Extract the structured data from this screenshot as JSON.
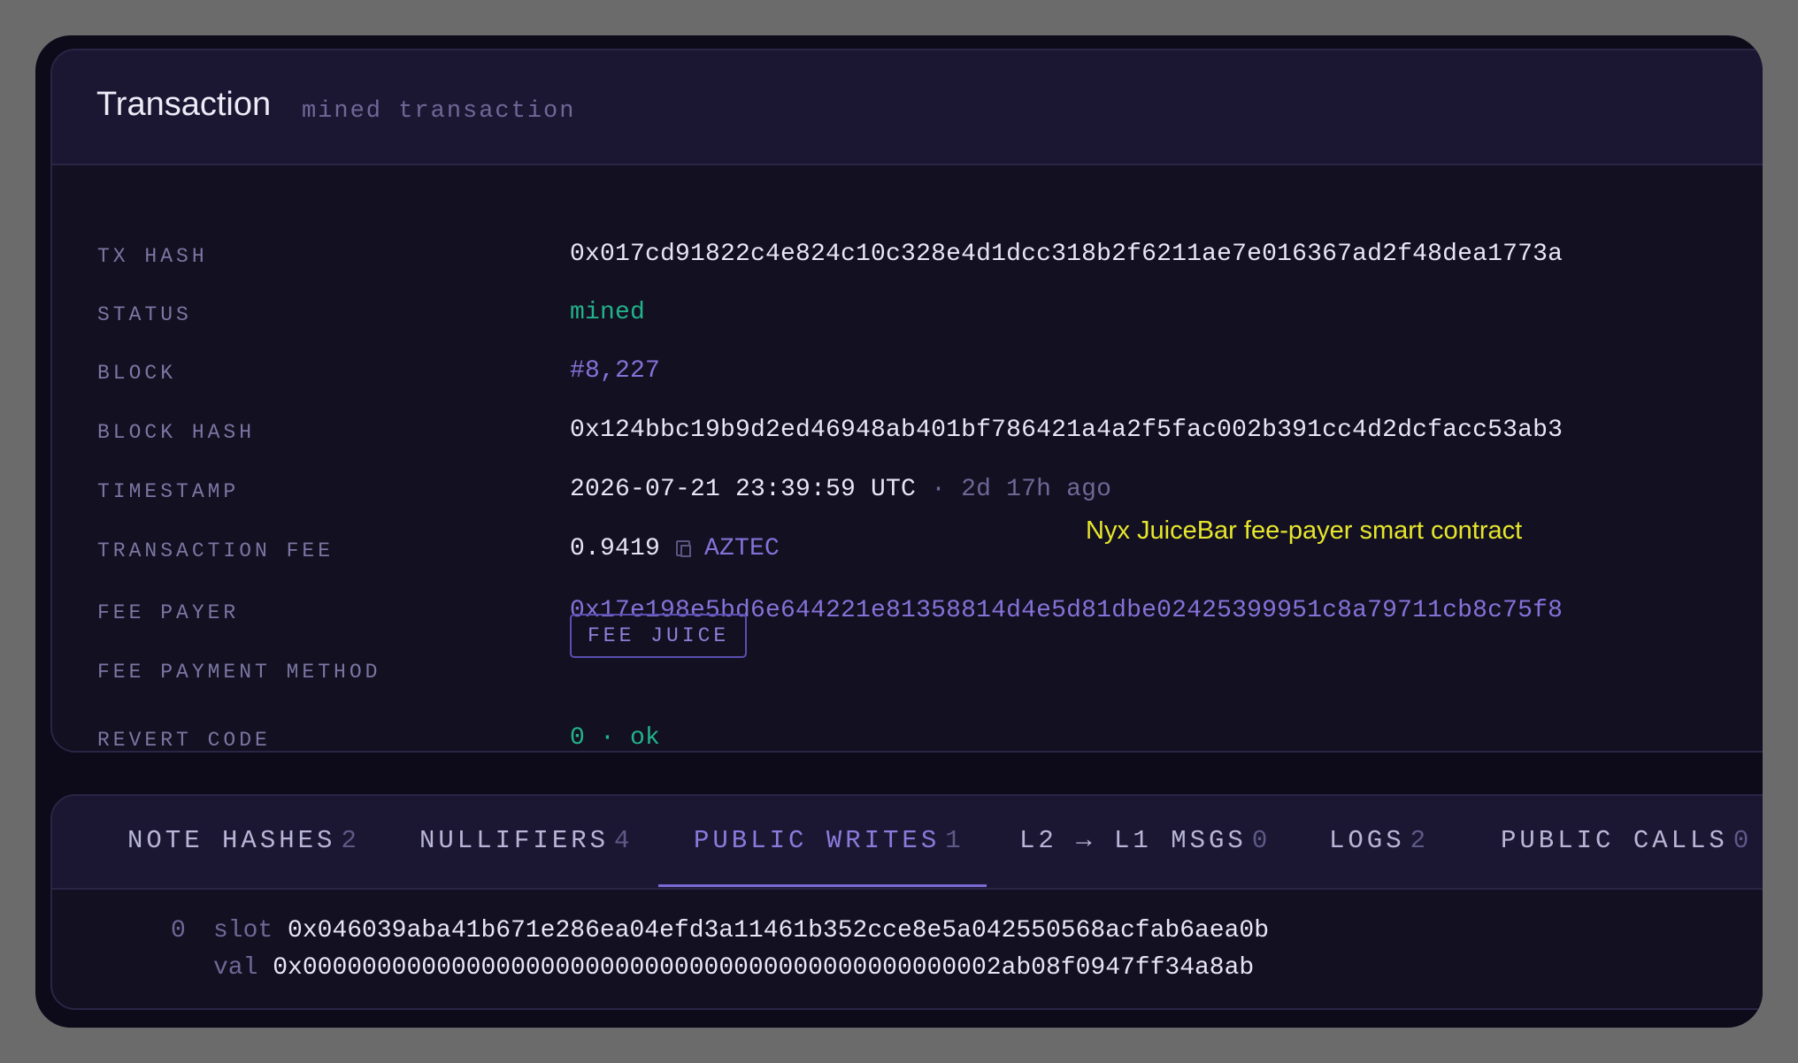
{
  "header": {
    "title": "Transaction",
    "subtitle": "mined transaction"
  },
  "details": {
    "tx_hash_label": "TX HASH",
    "tx_hash": "0x017cd91822c4e824c10c328e4d1dcc318b2f6211ae7e016367ad2f48dea1773a",
    "status_label": "STATUS",
    "status": "mined",
    "block_label": "BLOCK",
    "block": "#8,227",
    "block_hash_label": "BLOCK HASH",
    "block_hash": "0x124bbc19b9d2ed46948ab401bf786421a4a2f5fac002b391cc4d2dcfacc53ab3",
    "timestamp_label": "TIMESTAMP",
    "timestamp": "2026-07-21 23:39:59 UTC",
    "timestamp_sep": "·",
    "timestamp_relative": "2d 17h ago",
    "fee_label": "TRANSACTION FEE",
    "fee_amount": "0.9419",
    "fee_token": "AZTEC",
    "fee_payer_label": "FEE PAYER",
    "fee_payer": "0x17e198e5bd6e644221e81358814d4e5d81dbe02425399951c8a79711cb8c75f8",
    "fee_payer_annotation": "Nyx JuiceBar fee-payer smart contract",
    "fee_method_label": "FEE PAYMENT METHOD",
    "fee_method": "FEE JUICE",
    "revert_label": "REVERT CODE",
    "revert_code": "0 · ok"
  },
  "tabs": [
    {
      "label": "NOTE HASHES",
      "count": "2"
    },
    {
      "label": "NULLIFIERS",
      "count": "4"
    },
    {
      "label": "PUBLIC WRITES",
      "count": "1"
    },
    {
      "label": "L2 → L1 MSGS",
      "count": "0"
    },
    {
      "label": "LOGS",
      "count": "2"
    },
    {
      "label": "PUBLIC CALLS",
      "count": "0"
    }
  ],
  "active_tab": "PUBLIC WRITES",
  "public_writes": [
    {
      "index": "0",
      "slot_key": "slot",
      "slot": "0x046039aba41b671e286ea04efd3a11461b352cce8e5a042550568acfab6aea0b",
      "val_key": "val",
      "val": "0x00000000000000000000000000000000000000000000002ab08f0947ff34a8ab"
    }
  ],
  "colors": {
    "background": "#0d0a19",
    "card": "#131022",
    "header": "#1b1733",
    "accent": "#8572d8",
    "success": "#22b38a",
    "annotation": "#e6e62c"
  }
}
